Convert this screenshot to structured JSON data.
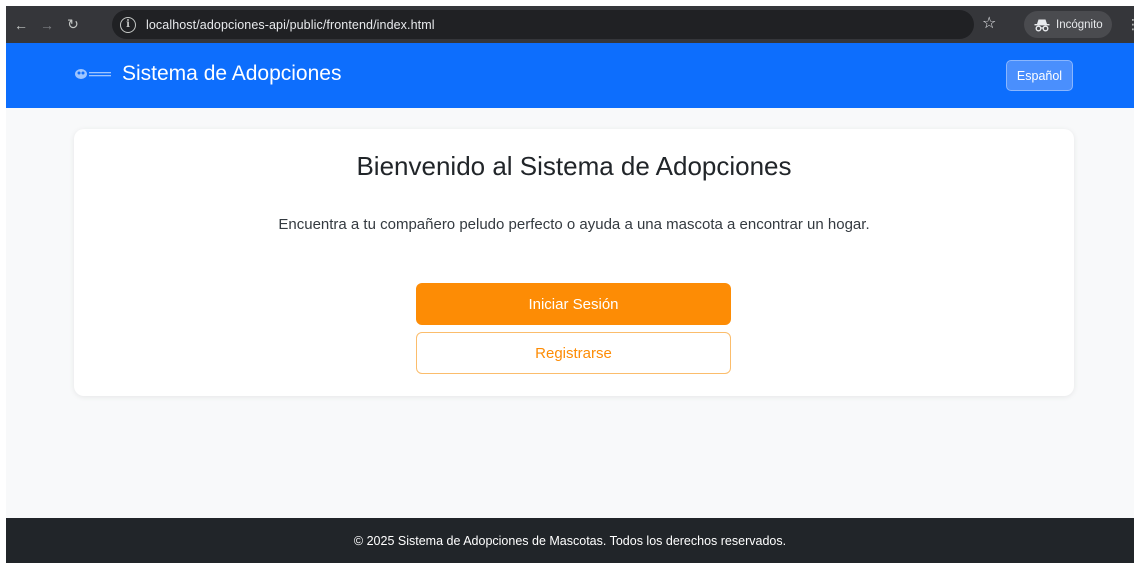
{
  "browser": {
    "url": "localhost/adopciones-api/public/frontend/index.html",
    "incognito_label": "Incógnito"
  },
  "navbar": {
    "brand": "Sistema de Adopciones",
    "language_button": "Español"
  },
  "card": {
    "title": "Bienvenido al Sistema de Adopciones",
    "text": "Encuentra a tu compañero peludo perfecto o ayuda a una mascota a encontrar un hogar.",
    "login_button": "Iniciar Sesión",
    "register_button": "Registrarse"
  },
  "footer": {
    "text": "© 2025 Sistema de Adopciones de Mascotas. Todos los derechos reservados."
  },
  "colors": {
    "navbar": "#0d6efd",
    "accent": "#fd8c05",
    "footer": "#212529"
  }
}
